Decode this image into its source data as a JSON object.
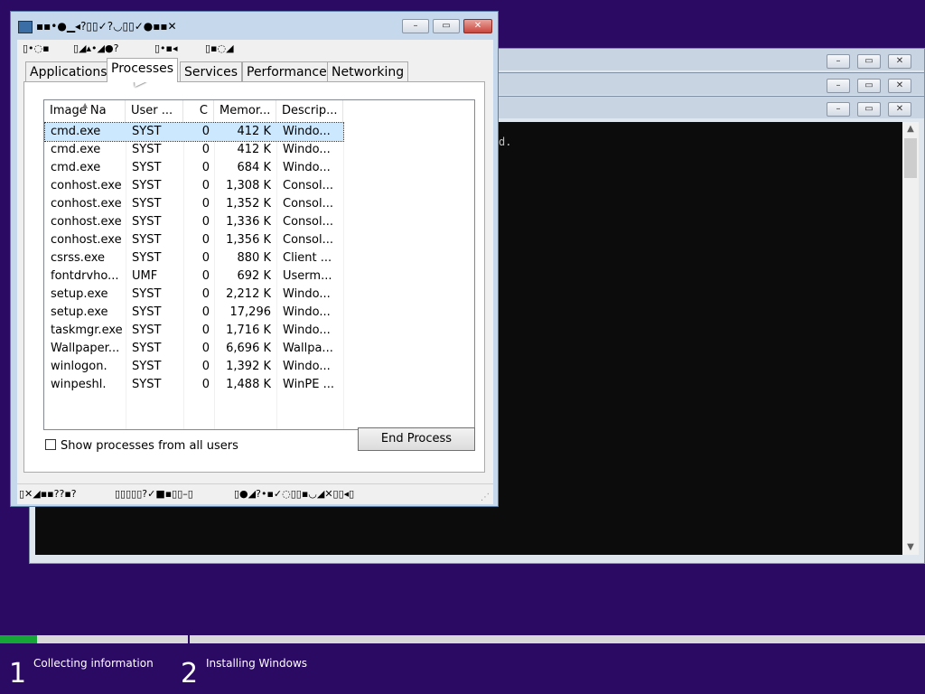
{
  "task_manager": {
    "title_glyphs": "▪▪•●▁◂?▯▯✓?◡▯▯✓●▪▪✕",
    "menu_glyphs": [
      "▯•◌▪",
      "▯◢▴•◢●?",
      "▯•▪◂",
      "▯▪◌◢"
    ],
    "tabs": [
      {
        "label": "Applications"
      },
      {
        "label": "Processes"
      },
      {
        "label": "Services"
      },
      {
        "label": "Performance"
      },
      {
        "label": "Networking"
      }
    ],
    "columns": [
      "Image Na",
      "User ...",
      "C",
      "Memor...",
      "Descrip..."
    ],
    "rows": [
      {
        "image": "cmd.exe",
        "user": "SYST",
        "cpu": "0",
        "mem": "412 K",
        "desc": "Windo..."
      },
      {
        "image": "cmd.exe",
        "user": "SYST",
        "cpu": "0",
        "mem": "412 K",
        "desc": "Windo..."
      },
      {
        "image": "cmd.exe",
        "user": "SYST",
        "cpu": "0",
        "mem": "684 K",
        "desc": "Windo..."
      },
      {
        "image": "conhost.exe",
        "user": "SYST",
        "cpu": "0",
        "mem": "1,308 K",
        "desc": "Consol..."
      },
      {
        "image": "conhost.exe",
        "user": "SYST",
        "cpu": "0",
        "mem": "1,352 K",
        "desc": "Consol..."
      },
      {
        "image": "conhost.exe",
        "user": "SYST",
        "cpu": "0",
        "mem": "1,336 K",
        "desc": "Consol..."
      },
      {
        "image": "conhost.exe",
        "user": "SYST",
        "cpu": "0",
        "mem": "1,356 K",
        "desc": "Consol..."
      },
      {
        "image": "csrss.exe",
        "user": "SYST",
        "cpu": "0",
        "mem": "880 K",
        "desc": "Client ..."
      },
      {
        "image": "fontdrvho...",
        "user": "UMF",
        "cpu": "0",
        "mem": "692 K",
        "desc": "Userm..."
      },
      {
        "image": "setup.exe",
        "user": "SYST",
        "cpu": "0",
        "mem": "2,212 K",
        "desc": "Windo..."
      },
      {
        "image": "setup.exe",
        "user": "SYST",
        "cpu": "0",
        "mem": "17,296",
        "desc": "Windo..."
      },
      {
        "image": "taskmgr.exe",
        "user": "SYST",
        "cpu": "0",
        "mem": "1,716 K",
        "desc": "Windo..."
      },
      {
        "image": "Wallpaper...",
        "user": "SYST",
        "cpu": "0",
        "mem": "6,696 K",
        "desc": "Wallpa..."
      },
      {
        "image": "winlogon.",
        "user": "SYST",
        "cpu": "0",
        "mem": "1,392 K",
        "desc": "Windo..."
      },
      {
        "image": "winpeshl.",
        "user": "SYST",
        "cpu": "0",
        "mem": "1,488 K",
        "desc": "WinPE ..."
      }
    ],
    "show_all_label": "Show processes from all users",
    "end_process_label": "End Process",
    "status_glyphs": [
      "▯✕◢▪▪??▪?",
      "▯▯▯▯▯?✓■▪▯▯–▯",
      "▯●◢?•▪✓◌▯▯▪◡◢✕▯▯◂▯"
    ]
  },
  "console": {
    "text_fragment": "d."
  },
  "setup_progress": {
    "fill_fraction": 0.04,
    "steps": [
      {
        "number": "1",
        "label": "Collecting information"
      },
      {
        "number": "2",
        "label": "Installing Windows"
      }
    ]
  },
  "colors": {
    "desktop": "#2b0a63",
    "progress_fill": "#16a637",
    "selection": "#cce8ff",
    "close_button": "#c9463d"
  }
}
